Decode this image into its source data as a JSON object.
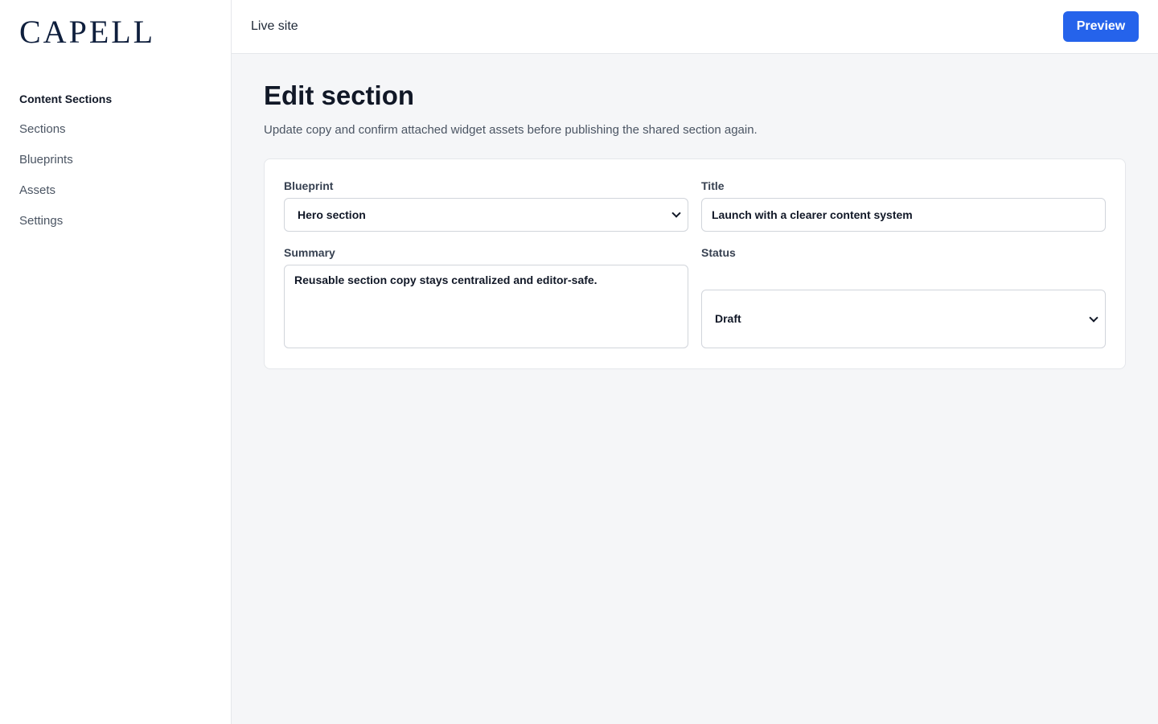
{
  "brand": {
    "logo_text": "CAPELL"
  },
  "sidebar": {
    "heading": "Content Sections",
    "items": [
      {
        "label": "Sections"
      },
      {
        "label": "Blueprints"
      },
      {
        "label": "Assets"
      },
      {
        "label": "Settings"
      }
    ]
  },
  "topbar": {
    "live_site_label": "Live site",
    "preview_label": "Preview"
  },
  "page": {
    "title": "Edit section",
    "subtitle": "Update copy and confirm attached widget assets before publishing the shared section again."
  },
  "form": {
    "blueprint": {
      "label": "Blueprint",
      "value": "Hero section"
    },
    "title": {
      "label": "Title",
      "value": "Launch with a clearer content system"
    },
    "summary": {
      "label": "Summary",
      "value": "Reusable section copy stays centralized and editor-safe."
    },
    "status": {
      "label": "Status",
      "value": "Draft"
    }
  },
  "colors": {
    "accent": "#2563eb",
    "logo": "#0f1f3d",
    "background": "#f5f6f8"
  }
}
